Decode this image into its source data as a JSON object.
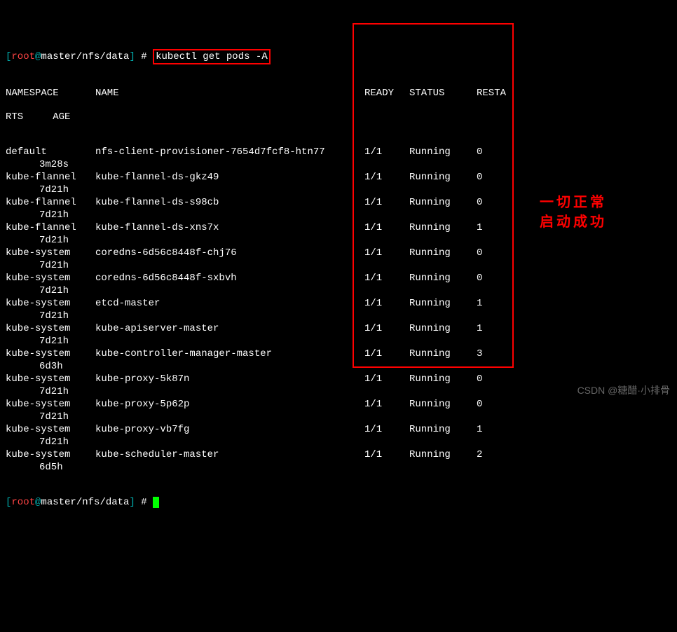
{
  "prompt": {
    "user": "root",
    "host": "master",
    "path": "/nfs/data",
    "command": "kubectl get pods -A"
  },
  "headers": {
    "namespace": "NAMESPACE",
    "name": "NAME",
    "ready": "READY",
    "status": "STATUS",
    "restarts": "RESTA",
    "rts": "RTS",
    "age": "AGE"
  },
  "rows": [
    {
      "namespace": "default",
      "name": "nfs-client-provisioner-7654d7fcf8-htn77",
      "ready": "1/1",
      "status": "Running",
      "restarts": "0",
      "age": "3m28s"
    },
    {
      "namespace": "kube-flannel",
      "name": "kube-flannel-ds-gkz49",
      "ready": "1/1",
      "status": "Running",
      "restarts": "0",
      "age": "7d21h"
    },
    {
      "namespace": "kube-flannel",
      "name": "kube-flannel-ds-s98cb",
      "ready": "1/1",
      "status": "Running",
      "restarts": "0",
      "age": "7d21h"
    },
    {
      "namespace": "kube-flannel",
      "name": "kube-flannel-ds-xns7x",
      "ready": "1/1",
      "status": "Running",
      "restarts": "1",
      "age": "7d21h"
    },
    {
      "namespace": "kube-system",
      "name": "coredns-6d56c8448f-chj76",
      "ready": "1/1",
      "status": "Running",
      "restarts": "0",
      "age": "7d21h"
    },
    {
      "namespace": "kube-system",
      "name": "coredns-6d56c8448f-sxbvh",
      "ready": "1/1",
      "status": "Running",
      "restarts": "0",
      "age": "7d21h"
    },
    {
      "namespace": "kube-system",
      "name": "etcd-master",
      "ready": "1/1",
      "status": "Running",
      "restarts": "1",
      "age": "7d21h"
    },
    {
      "namespace": "kube-system",
      "name": "kube-apiserver-master",
      "ready": "1/1",
      "status": "Running",
      "restarts": "1",
      "age": "7d21h"
    },
    {
      "namespace": "kube-system",
      "name": "kube-controller-manager-master",
      "ready": "1/1",
      "status": "Running",
      "restarts": "3",
      "age": "6d3h"
    },
    {
      "namespace": "kube-system",
      "name": "kube-proxy-5k87n",
      "ready": "1/1",
      "status": "Running",
      "restarts": "0",
      "age": "7d21h"
    },
    {
      "namespace": "kube-system",
      "name": "kube-proxy-5p62p",
      "ready": "1/1",
      "status": "Running",
      "restarts": "0",
      "age": "7d21h"
    },
    {
      "namespace": "kube-system",
      "name": "kube-proxy-vb7fg",
      "ready": "1/1",
      "status": "Running",
      "restarts": "1",
      "age": "7d21h"
    },
    {
      "namespace": "kube-system",
      "name": "kube-scheduler-master",
      "ready": "1/1",
      "status": "Running",
      "restarts": "2",
      "age": "6d5h"
    }
  ],
  "annotation": {
    "line1": "一切正常",
    "line2": "启动成功"
  },
  "watermark": "CSDN @糖醋·小排骨"
}
